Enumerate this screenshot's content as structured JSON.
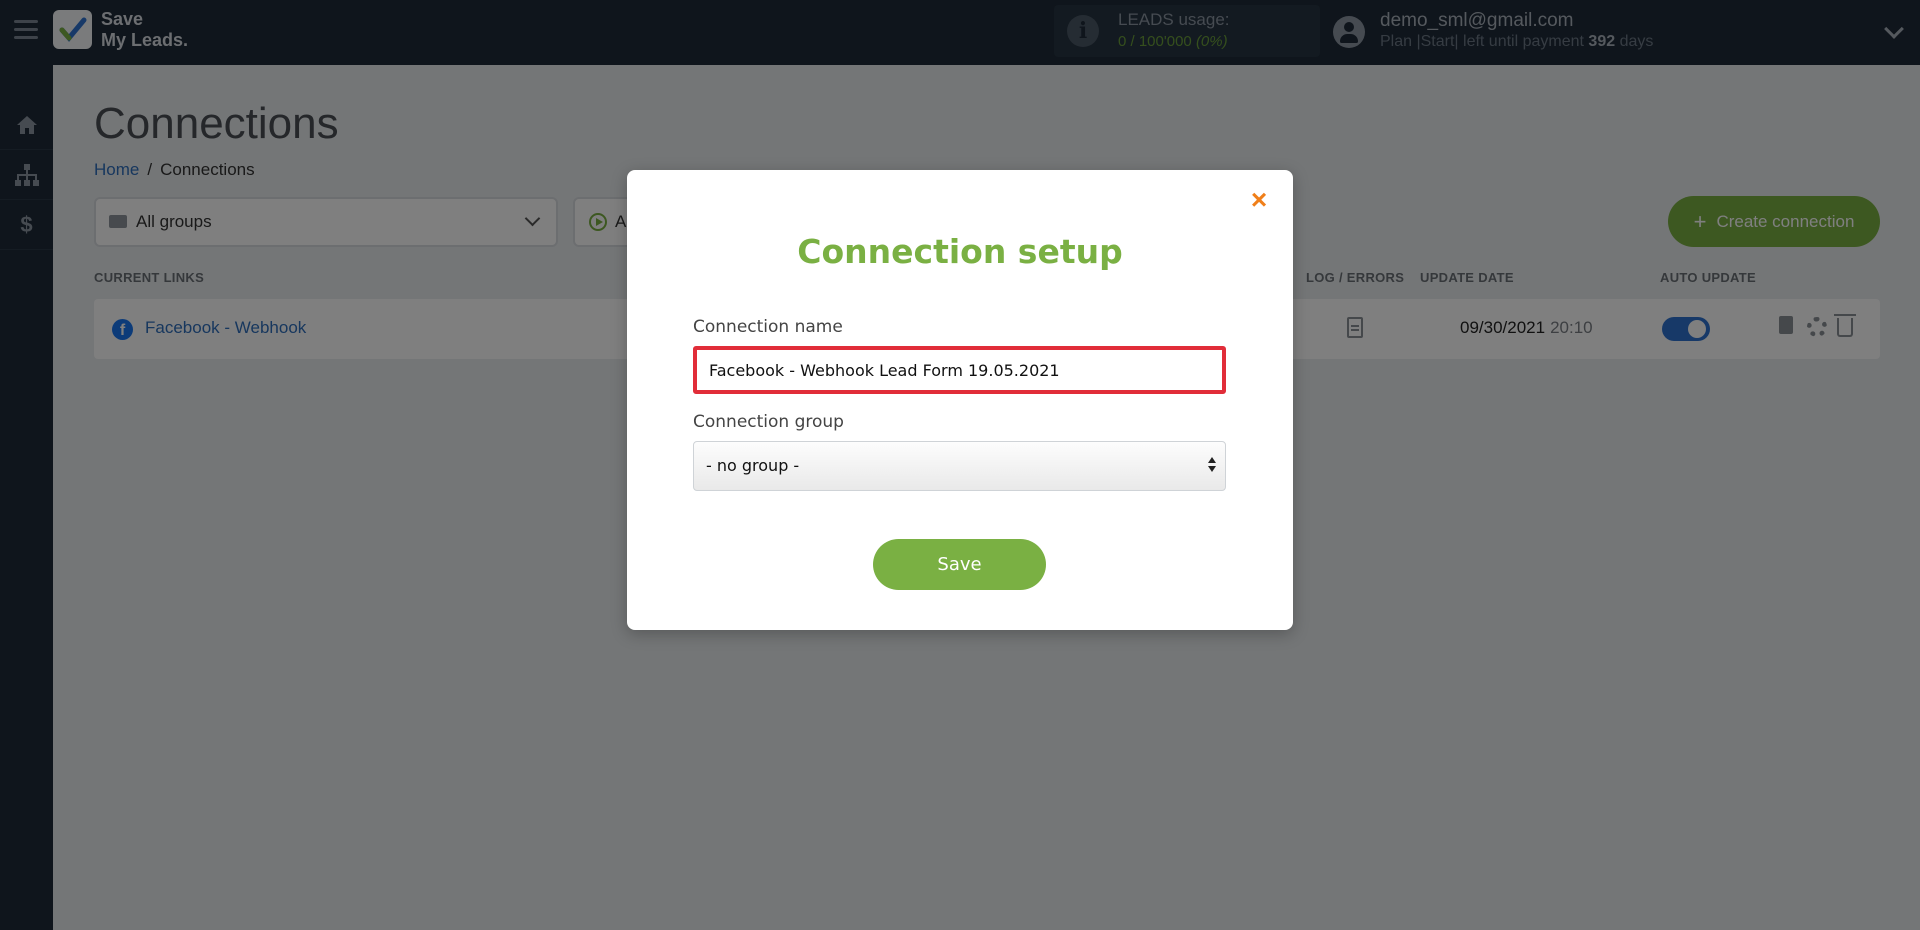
{
  "topbar": {
    "logo_line1": "Save",
    "logo_line2": "My Leads.",
    "leads_label": "LEADS usage:",
    "leads_value": "0 / 100'000",
    "leads_percent": "(0%)",
    "user_email": "demo_sml@gmail.com",
    "plan_text": "Plan |Start| left until payment",
    "days_left": "392",
    "days_unit": "days"
  },
  "sidebar": {
    "items": [
      {
        "icon": "home-icon"
      },
      {
        "icon": "sitemap-icon"
      },
      {
        "icon": "dollar-icon"
      }
    ]
  },
  "page": {
    "title": "Connections",
    "breadcrumb": {
      "home": "Home",
      "sep": "/",
      "current": "Connections"
    },
    "group_filter": "All groups",
    "status_filter": "A",
    "create_button": "Create connection",
    "columns": {
      "current_links": "CURRENT LINKS",
      "log_errors": "LOG / ERRORS",
      "update_date": "UPDATE DATE",
      "auto_update": "AUTO UPDATE"
    },
    "rows": [
      {
        "name": "Facebook - Webhook",
        "date": "09/30/2021",
        "time": "20:10",
        "auto_update": true
      }
    ]
  },
  "modal": {
    "close_glyph": "×",
    "title": "Connection setup",
    "name_label": "Connection name",
    "name_value": "Facebook - Webhook Lead Form 19.05.2021",
    "group_label": "Connection group",
    "group_value": "- no group -",
    "save_label": "Save"
  },
  "colors": {
    "brand_green": "#7ab043",
    "topbar": "#1e2a38",
    "highlight_red": "#e12d39",
    "close_orange": "#f07f1a",
    "link_blue": "#2f6fbd"
  }
}
